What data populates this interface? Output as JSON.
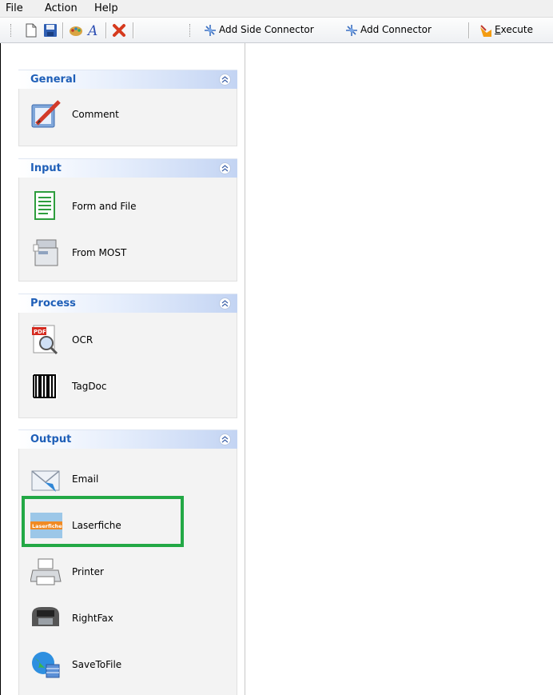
{
  "menu": {
    "file": "File",
    "action": "Action",
    "help": "Help"
  },
  "toolbar": {
    "add_side_connector": "Add Side Connector",
    "add_connector": "Add Connector",
    "execute": "Execute",
    "icons": [
      "new-document-icon",
      "save-icon",
      "palette-icon",
      "font-icon",
      "delete-icon"
    ]
  },
  "groups": {
    "general": {
      "title": "General",
      "items": [
        {
          "label": "Comment",
          "icon": "comment-icon"
        }
      ]
    },
    "input": {
      "title": "Input",
      "items": [
        {
          "label": "Form and File",
          "icon": "form-file-icon"
        },
        {
          "label": "From MOST",
          "icon": "mfp-icon"
        }
      ]
    },
    "process": {
      "title": "Process",
      "items": [
        {
          "label": "OCR",
          "icon": "pdf-ocr-icon"
        },
        {
          "label": "TagDoc",
          "icon": "barcode-icon"
        }
      ]
    },
    "output": {
      "title": "Output",
      "items": [
        {
          "label": "Email",
          "icon": "email-icon"
        },
        {
          "label": "Laserfiche",
          "icon": "laserfiche-icon",
          "logo_text": "Laserfiche"
        },
        {
          "label": "Printer",
          "icon": "printer-icon"
        },
        {
          "label": "RightFax",
          "icon": "fax-icon"
        },
        {
          "label": "SaveToFile",
          "icon": "globe-save-icon"
        }
      ]
    }
  },
  "colors": {
    "highlight": "#22a845",
    "group_title": "#1f5fb8"
  }
}
